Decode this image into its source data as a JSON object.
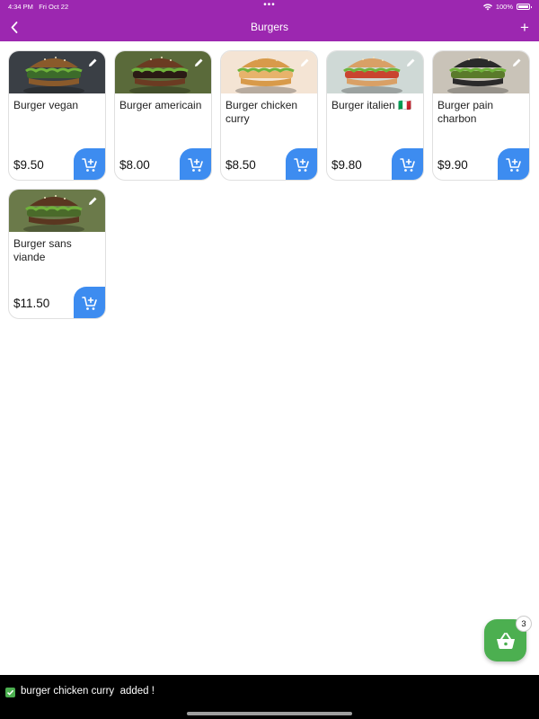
{
  "status_bar": {
    "time": "4:34 PM",
    "date": "Fri Oct 22",
    "battery": "100%"
  },
  "header": {
    "title": "Burgers",
    "add_label": "+"
  },
  "products": [
    {
      "name": "Burger vegan",
      "price": "$9.50",
      "bun": "#8a5a2b",
      "fill": "#3c6b2a",
      "bg": "#3a3f45"
    },
    {
      "name": "Burger americain",
      "price": "$8.00",
      "bun": "#6b3b22",
      "fill": "#2a1a14",
      "bg": "#5a6a3a"
    },
    {
      "name": "Burger chicken curry",
      "price": "$8.50",
      "bun": "#d89a4a",
      "fill": "#e7b36b",
      "bg": "#f4e4d4"
    },
    {
      "name": "Burger italien 🇮🇹",
      "price": "$9.80",
      "bun": "#d9a066",
      "fill": "#c9442f",
      "bg": "#cfd9d6"
    },
    {
      "name": "Burger pain charbon",
      "price": "$9.90",
      "bun": "#2a2a2a",
      "fill": "#5a7a2a",
      "bg": "#c9c3b8"
    },
    {
      "name": "Burger sans viande",
      "price": "$11.50",
      "bun": "#5a3620",
      "fill": "#4a6a2a",
      "bg": "#6b7a4a"
    }
  ],
  "basket": {
    "count": "3"
  },
  "toast": {
    "message": "burger chicken curry  added !"
  },
  "colors": {
    "header": "#9c27b0",
    "cart_button": "#3d8cf0",
    "basket": "#4caf50"
  },
  "icons": {
    "back": "chevron-left-icon",
    "add": "plus-icon",
    "edit": "pencil-icon",
    "cart": "add-to-cart-icon",
    "basket": "basket-icon",
    "toast": "check-box-icon"
  }
}
